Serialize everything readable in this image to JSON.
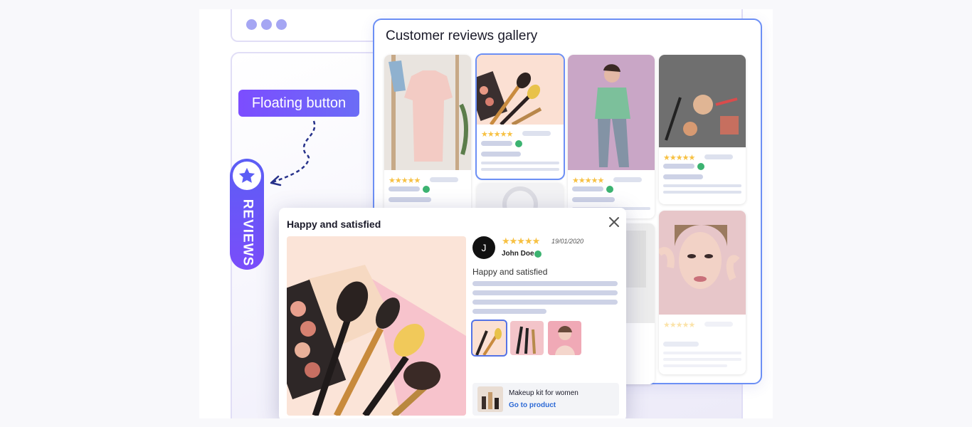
{
  "floating_button_label": "Floating button",
  "reviews_tab_label": "REVIEWS",
  "gallery": {
    "title": "Customer reviews gallery",
    "cards": [
      {
        "id": "shirt",
        "stars": "★★★★★",
        "verified": true
      },
      {
        "id": "makeup",
        "stars": "★★★★★",
        "verified": true
      },
      {
        "id": "woman",
        "stars": "★★★★★",
        "verified": true
      },
      {
        "id": "cosmetics",
        "stars": "★★★★★",
        "verified": true
      },
      {
        "id": "portrait",
        "stars": "★★★★★",
        "verified": false
      }
    ]
  },
  "review_modal": {
    "title": "Happy and satisfied",
    "close_icon": "close-icon",
    "avatar_initial": "J",
    "rating": "★★★★★",
    "date": "19/01/2020",
    "author": "John Doe",
    "verified": true,
    "text": "Happy and satisfied",
    "thumbnails": [
      "makeup-brushes",
      "brush-set",
      "woman-portrait"
    ],
    "product": {
      "name": "Makeup kit for women",
      "link_label": "Go to product"
    }
  },
  "colors": {
    "accent": "#6c8ff5",
    "purple": "#7c4dff",
    "star": "#f7c143",
    "verified": "#3cb371"
  }
}
